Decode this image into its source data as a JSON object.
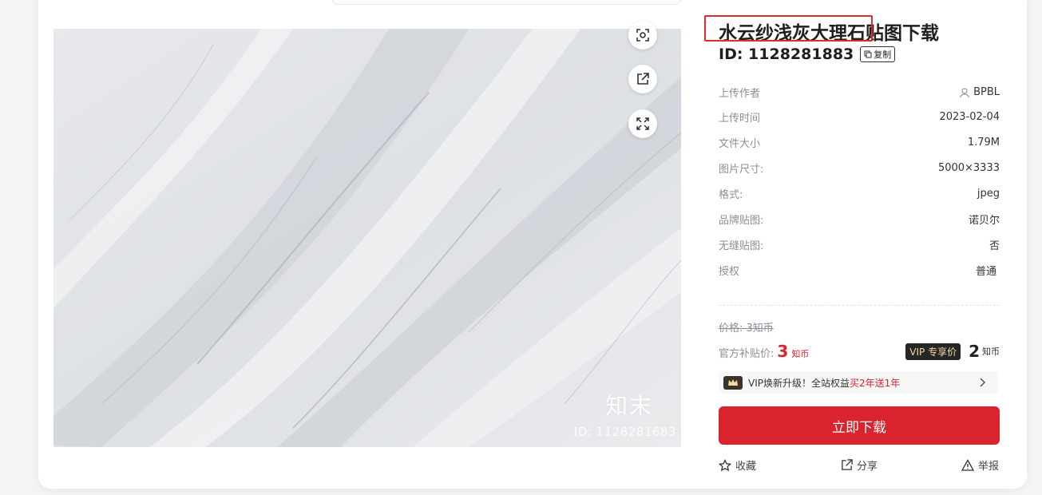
{
  "product": {
    "title": "水云纱浅灰大理石贴图下载",
    "id_line": "ID: 1128281883",
    "copy_label": "复制"
  },
  "image": {
    "watermark_logo": "知末",
    "watermark_id": "ID: 1128281683"
  },
  "tools": {
    "icons": [
      "scan-icon",
      "external-link-icon",
      "fullscreen-icon"
    ]
  },
  "meta": [
    {
      "key": "上传作者",
      "value": "BPBL"
    },
    {
      "key": "上传时间",
      "value": "2023-02-04"
    },
    {
      "key": "文件大小",
      "value": "1.79M"
    },
    {
      "key": "图片尺寸:",
      "value": "5000×3333"
    },
    {
      "key": "格式:",
      "value": "jpeg"
    },
    {
      "key": "品牌贴图:",
      "value": "诺贝尔"
    },
    {
      "key": "无缝贴图:",
      "value": "否"
    },
    {
      "key": "授权",
      "value": "普通"
    }
  ],
  "pricing": {
    "original": "价格: 3知币",
    "official_label": "官方补贴价:",
    "official_value": "3",
    "coin_unit": "知币",
    "vip_tag": "VIP 专享价",
    "vip_value": "2"
  },
  "vip_banner": {
    "text": "VIP焕新升级！全站权益",
    "highlight": "买2年送1年"
  },
  "download_label": "立即下载",
  "actions": {
    "favorite": "收藏",
    "share": "分享",
    "report": "举报"
  },
  "colors": {
    "accent": "#d9232e",
    "vip_dark": "#262626",
    "vip_gold": "#f3d9a4"
  }
}
